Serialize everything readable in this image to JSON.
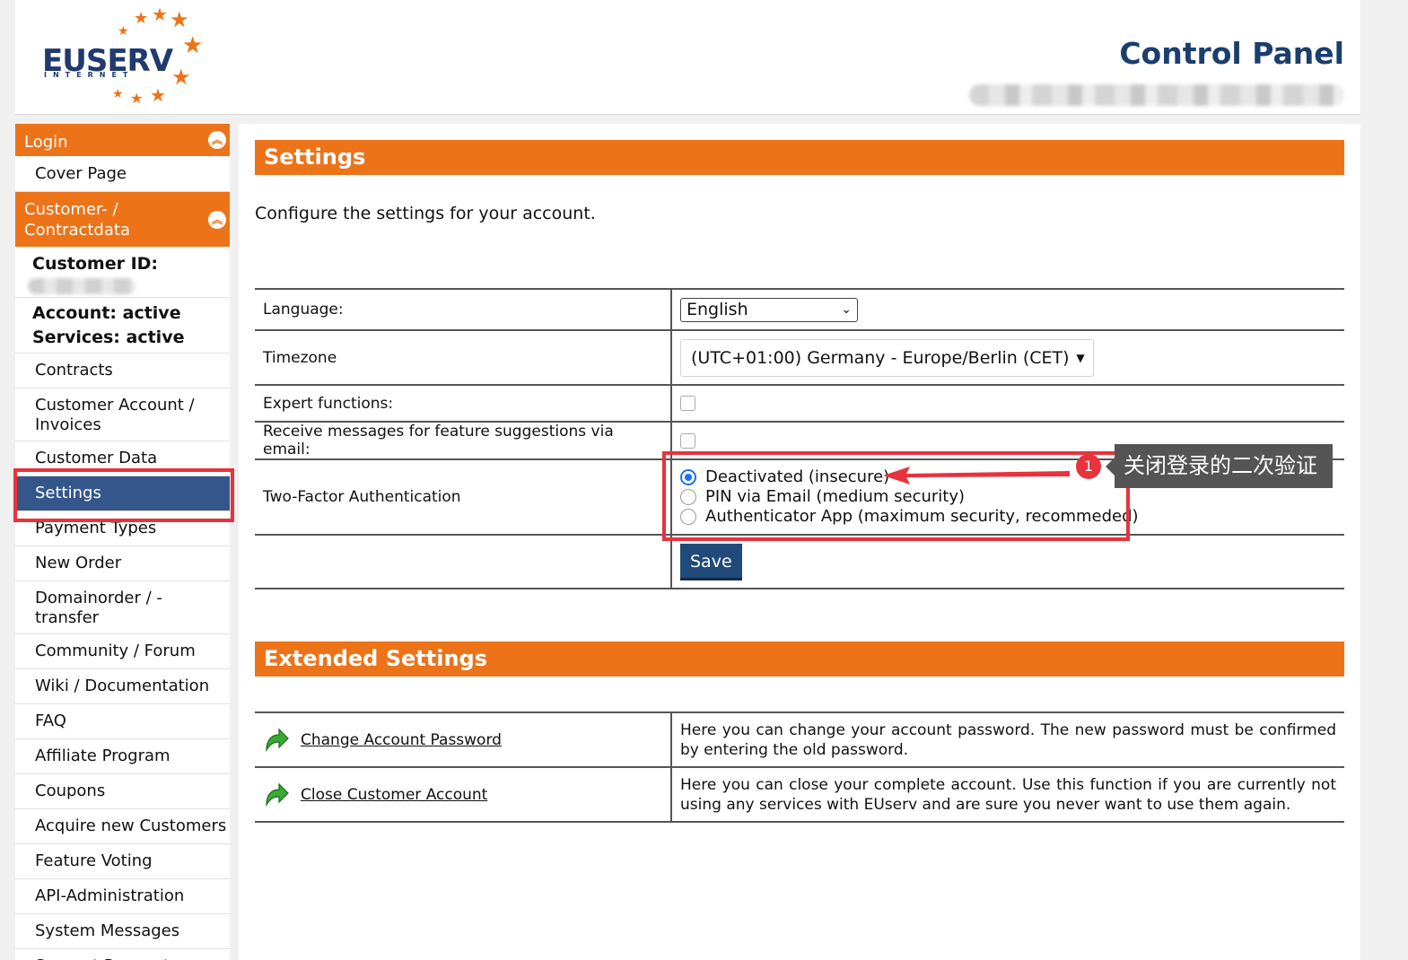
{
  "header": {
    "logo_text": "EUSERV",
    "logo_subtext": "INTERNET",
    "title": "Control Panel"
  },
  "sidebar": {
    "sections": [
      {
        "label": "Login",
        "items": [
          {
            "label": "Cover Page"
          }
        ]
      },
      {
        "label": "Customer- / Contractdata",
        "items": []
      }
    ],
    "customer_id_label": "Customer ID:",
    "account_status": "Account: active",
    "services_status": "Services: active",
    "items": [
      {
        "label": "Contracts"
      },
      {
        "label": "Customer Account / Invoices"
      },
      {
        "label": "Customer Data"
      },
      {
        "label": "Settings",
        "active": true
      },
      {
        "label": "Payment Types"
      },
      {
        "label": "New Order"
      },
      {
        "label": "Domainorder / -transfer"
      },
      {
        "label": "Community / Forum"
      },
      {
        "label": "Wiki / Documentation"
      },
      {
        "label": "FAQ"
      },
      {
        "label": "Affiliate Program"
      },
      {
        "label": "Coupons"
      },
      {
        "label": "Acquire new Customers"
      },
      {
        "label": "Feature Voting"
      },
      {
        "label": "API-Administration"
      },
      {
        "label": "System Messages"
      },
      {
        "label": "Support Requests"
      }
    ]
  },
  "settings": {
    "title": "Settings",
    "intro": "Configure the settings for your account.",
    "language_label": "Language:",
    "language_value": "English",
    "timezone_label": "Timezone",
    "timezone_value": "(UTC+01:00) Germany - Europe/Berlin (CET)",
    "expert_label": "Expert functions:",
    "feature_msg_label": "Receive messages for feature suggestions via email:",
    "two_factor_label": "Two-Factor Authentication",
    "two_factor_options": [
      {
        "label": "Deactivated (insecure)",
        "checked": true
      },
      {
        "label": "PIN via Email (medium security)",
        "checked": false
      },
      {
        "label": "Authenticator App (maximum security, recommeded)",
        "checked": false
      }
    ],
    "save_label": "Save"
  },
  "extended": {
    "title": "Extended Settings",
    "rows": [
      {
        "link": "Change Account Password",
        "desc": "Here you can change your account password. The new password must be confirmed by entering the old password."
      },
      {
        "link": "Close Customer Account",
        "desc": "Here you can close your complete account. Use this function if you are currently not using any services with EUserv and are sure you never want to use them again."
      }
    ]
  },
  "annotation": {
    "step_number": "1",
    "tip_text": "关闭登录的二次验证",
    "color": "#e8323c"
  },
  "colors": {
    "accent_orange": "#ec7318",
    "active_blue": "#34568b",
    "title_blue": "#1b3f6d",
    "save_blue": "#1f4a7a"
  }
}
